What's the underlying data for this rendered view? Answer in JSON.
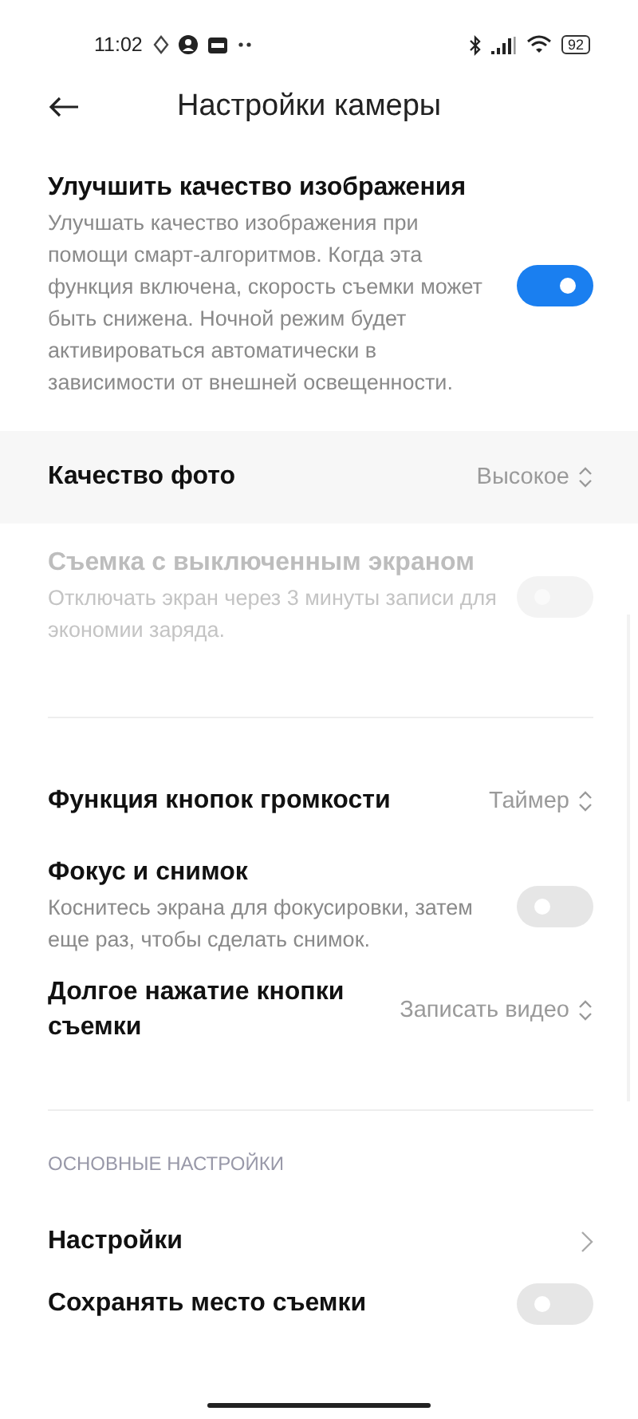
{
  "status_bar": {
    "time": "11:02",
    "battery": "92"
  },
  "header": {
    "title": "Настройки камеры"
  },
  "items": [
    {
      "kind": "toggle",
      "title": "Улучшить качество изображения",
      "description": "Улучшать качество изображения при помощи смарт-алгоритмов. Когда эта функция включена, скорость съемки может быть снижена. Ночной режим будет активироваться автоматически в зависимости от внешней освещенности.",
      "on": true,
      "disabled": false
    },
    {
      "kind": "select",
      "title": "Качество фото",
      "value": "Высокое",
      "highlighted": true
    },
    {
      "kind": "toggle",
      "title": "Съемка с выключенным экраном",
      "description": "Отключать экран через 3 минуты записи для экономии заряда.",
      "on": false,
      "disabled": true
    },
    {
      "kind": "divider"
    },
    {
      "kind": "select",
      "title": "Функция кнопок громкости",
      "value": "Таймер",
      "highlighted": false
    },
    {
      "kind": "toggle",
      "title": "Фокус и снимок",
      "description": "Коснитесь экрана для фокусировки, затем еще раз, чтобы сделать снимок.",
      "on": false,
      "disabled": false
    },
    {
      "kind": "select",
      "title": "Долгое нажатие кнопки съемки",
      "value": "Записать видео",
      "highlighted": false
    },
    {
      "kind": "divider"
    },
    {
      "kind": "section",
      "title": "ОСНОВНЫЕ НАСТРОЙКИ"
    },
    {
      "kind": "link",
      "title": "Настройки"
    },
    {
      "kind": "toggle",
      "title": "Сохранять место съемки",
      "on": false,
      "disabled": false
    }
  ]
}
